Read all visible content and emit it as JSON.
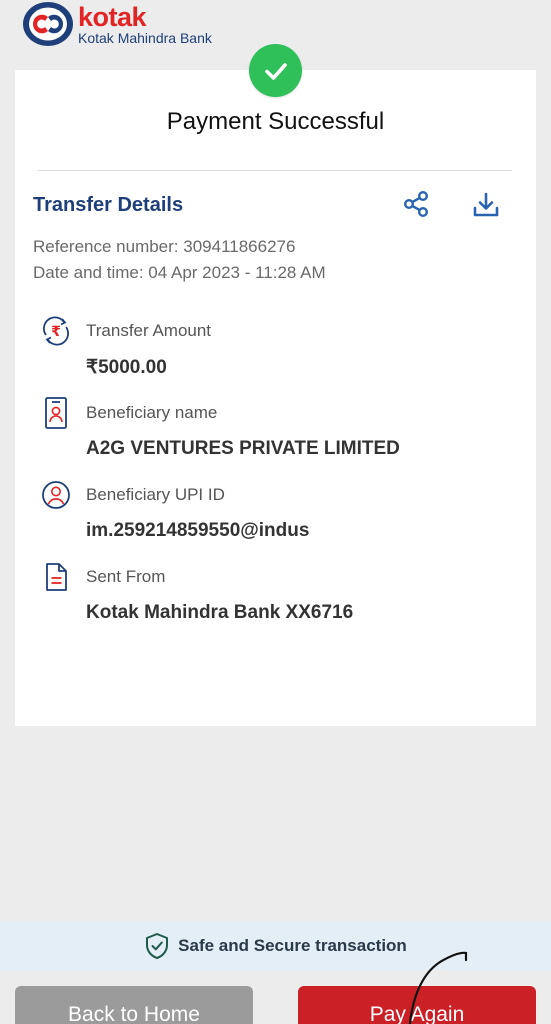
{
  "brand": {
    "name": "kotak",
    "subtitle": "Kotak Mahindra Bank"
  },
  "status": {
    "title": "Payment Successful"
  },
  "details": {
    "section_title": "Transfer Details",
    "reference": "Reference number: 309411866276",
    "datetime": "Date and time: 04 Apr 2023 - 11:28 AM",
    "rows": [
      {
        "icon": "rupee-transfer-icon",
        "label": "Transfer Amount",
        "value": "₹5000.00"
      },
      {
        "icon": "id-card-icon",
        "label": "Beneficiary name",
        "value": "A2G VENTURES PRIVATE LIMITED"
      },
      {
        "icon": "user-circle-icon",
        "label": "Beneficiary UPI ID",
        "value": "im.259214859550@indus"
      },
      {
        "icon": "document-icon",
        "label": "Sent From",
        "value": "Kotak Mahindra Bank XX6716"
      }
    ]
  },
  "footer": {
    "secure_text": "Safe and Secure transaction",
    "back_label": "Back to Home",
    "pay_label": "Pay Again"
  },
  "colors": {
    "brand_red": "#e32424",
    "brand_blue": "#1f3f7a",
    "success_green": "#2fc05a",
    "pay_button": "#cc2027",
    "home_button": "#9b9b9b",
    "icon_blue": "#2a64b0"
  }
}
